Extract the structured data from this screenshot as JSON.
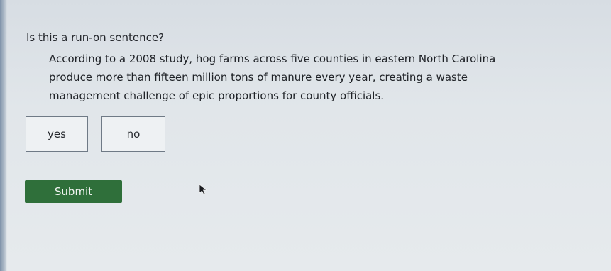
{
  "question": {
    "prompt": "Is this a run-on sentence?",
    "passage_lines": [
      "According to a 2008 study, hog farms across five counties in eastern North Carolina",
      "produce more than fifteen million tons of manure every year, creating a waste",
      "management challenge of epic proportions for county officials."
    ]
  },
  "choices": {
    "yes_label": "yes",
    "no_label": "no"
  },
  "actions": {
    "submit_label": "Submit"
  },
  "colors": {
    "submit_bg": "#2f6f3a",
    "choice_border": "#6f7a86"
  },
  "icons": {
    "pointer": "mouse-pointer-icon"
  }
}
